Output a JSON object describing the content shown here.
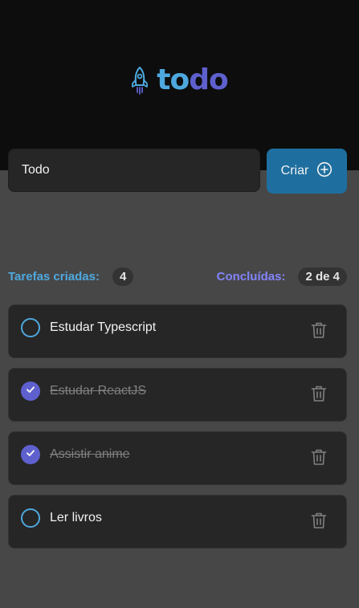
{
  "header": {
    "logo_part_1": "to",
    "logo_part_2": "do",
    "logo_icon": "rocket-icon"
  },
  "form": {
    "input_value": "Todo",
    "create_label": "Criar",
    "create_icon": "plus-circle-icon"
  },
  "info": {
    "created_label": "Tarefas criadas:",
    "created_count": "4",
    "done_label": "Concluídas:",
    "done_count": "2 de 4"
  },
  "tasks": [
    {
      "text": "Estudar Typescript",
      "done": false
    },
    {
      "text": "Estudar ReactJS",
      "done": true
    },
    {
      "text": "Assistir anime",
      "done": true
    },
    {
      "text": "Ler livros",
      "done": false
    }
  ],
  "colors": {
    "background": "#474747",
    "header": "#0d0d0d",
    "blue": "#4ea8de",
    "blue_dark": "#1e6f9f",
    "purple": "#5e60ce",
    "purple_light": "#8284fa",
    "card": "#262626"
  }
}
